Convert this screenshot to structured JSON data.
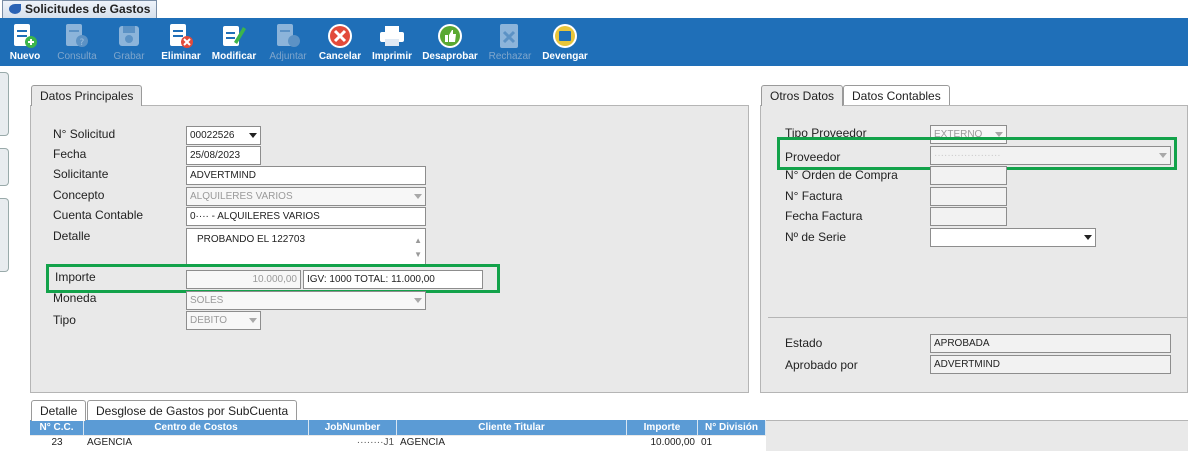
{
  "window": {
    "tab_title": "Solicitudes de Gastos"
  },
  "toolbar": {
    "nuevo": "Nuevo",
    "consulta": "Consulta",
    "grabar": "Grabar",
    "eliminar": "Eliminar",
    "modificar": "Modificar",
    "adjuntar": "Adjuntar",
    "cancelar": "Cancelar",
    "imprimir": "Imprimir",
    "desaprobar": "Desaprobar",
    "rechazar": "Rechazar",
    "devengar": "Devengar"
  },
  "left_panel": {
    "tab": "Datos Principales",
    "n_solicitud_label": "N° Solicitud",
    "n_solicitud": "00022526",
    "fecha_label": "Fecha",
    "fecha": "25/08/2023",
    "solicitante_label": "Solicitante",
    "solicitante": "ADVERTMIND",
    "concepto_label": "Concepto",
    "concepto": "ALQUILERES VARIOS",
    "cuenta_label": "Cuenta Contable",
    "cuenta": "0···· - ALQUILERES VARIOS",
    "detalle_label": "Detalle",
    "detalle": "PROBANDO EL 122703",
    "importe_label": "Importe",
    "importe": "10.000,00",
    "igv_total": "IGV: 1000 TOTAL:  11.000,00",
    "moneda_label": "Moneda",
    "moneda": "SOLES",
    "tipo_label": "Tipo",
    "tipo": "DEBITO"
  },
  "right_panel": {
    "tab_otros": "Otros Datos",
    "tab_contables": "Datos Contables",
    "tipo_proveedor_label": "Tipo Proveedor",
    "tipo_proveedor": "EXTERNO",
    "proveedor_label": "Proveedor",
    "proveedor": "····················",
    "orden_compra_label": "N° Orden de Compra",
    "factura_label": "N° Factura",
    "fecha_factura_label": "Fecha Factura",
    "serie_label": "Nº de Serie",
    "estado_label": "Estado",
    "estado": "APROBADA",
    "aprobado_por_label": "Aprobado por",
    "aprobado_por": "ADVERTMIND"
  },
  "bottom": {
    "tab_detalle": "Detalle",
    "tab_desglose": "Desglose de Gastos por SubCuenta",
    "columns": [
      "N° C.C.",
      "Centro de Costos",
      "JobNumber",
      "Cliente Titular",
      "Importe",
      "N° División"
    ],
    "rows": [
      {
        "cc": "23",
        "centro": "AGENCIA",
        "job": "········J1",
        "cliente": "AGENCIA",
        "importe": "10.000,00",
        "division": "01"
      }
    ]
  },
  "colors": {
    "toolbar": "#1f6fb8",
    "highlight": "#12a24a",
    "grid_header": "#5b9bd5"
  }
}
